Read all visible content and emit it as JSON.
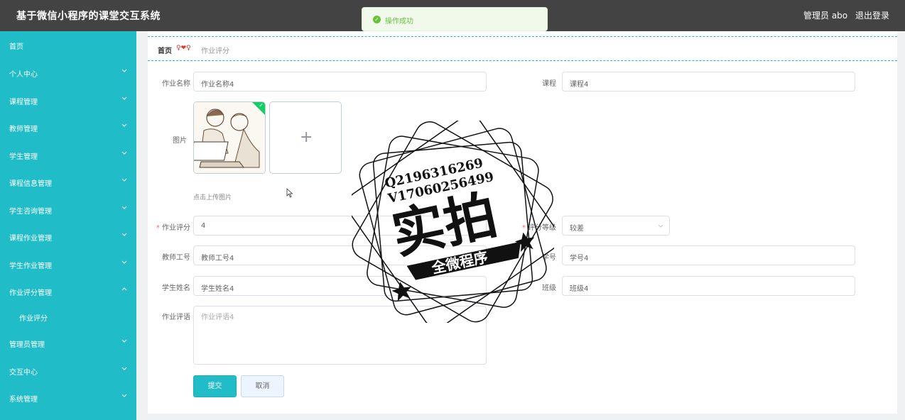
{
  "header": {
    "app_title": "基于微信小程序的课堂交互系统",
    "admin_label": "管理员 abo",
    "logout": "退出登录"
  },
  "toast": {
    "message": "操作成功"
  },
  "sidebar": {
    "items": [
      {
        "label": "首页",
        "has_arrow": false
      },
      {
        "label": "个人中心",
        "has_arrow": true
      },
      {
        "label": "课程管理",
        "has_arrow": true
      },
      {
        "label": "教师管理",
        "has_arrow": true
      },
      {
        "label": "学生管理",
        "has_arrow": true
      },
      {
        "label": "课程信息管理",
        "has_arrow": true
      },
      {
        "label": "学生咨询管理",
        "has_arrow": true
      },
      {
        "label": "课程作业管理",
        "has_arrow": true
      },
      {
        "label": "学生作业管理",
        "has_arrow": true
      },
      {
        "label": "作业评分管理",
        "has_arrow": true,
        "expanded": true
      },
      {
        "label": "作业评分",
        "sub": true
      },
      {
        "label": "管理员管理",
        "has_arrow": true
      },
      {
        "label": "交互中心",
        "has_arrow": true
      },
      {
        "label": "系统管理",
        "has_arrow": true
      }
    ]
  },
  "breadcrumb": {
    "home": "首页",
    "decoration": "♀❤♀",
    "current": "作业评分"
  },
  "form": {
    "homework_name": {
      "label": "作业名称",
      "value": "作业名称4"
    },
    "course": {
      "label": "课程",
      "value": "课程4"
    },
    "image": {
      "label": "图片",
      "tip": "点击上传图片"
    },
    "score": {
      "label": "作业评分",
      "value": "4"
    },
    "grade_level": {
      "label": "评分等级",
      "value": "较差"
    },
    "teacher_no": {
      "label": "教师工号",
      "value": "教师工号4"
    },
    "student_no": {
      "label": "学号",
      "value": "学号4"
    },
    "student_name": {
      "label": "学生姓名",
      "value": "学生姓名4"
    },
    "class": {
      "label": "班级",
      "value": "班级4"
    },
    "comment": {
      "label": "作业评语",
      "placeholder": "作业评语4"
    },
    "required_mark": "*",
    "submit": "提交",
    "cancel": "取消"
  },
  "watermark": {
    "line1": "Q2196316269",
    "line2": "V17060256499",
    "big": "实拍",
    "banner": "全微程序"
  },
  "colors": {
    "accent": "#20bdc9",
    "topbar": "#434343",
    "success": "#67c23a",
    "required": "#f56c6c"
  }
}
